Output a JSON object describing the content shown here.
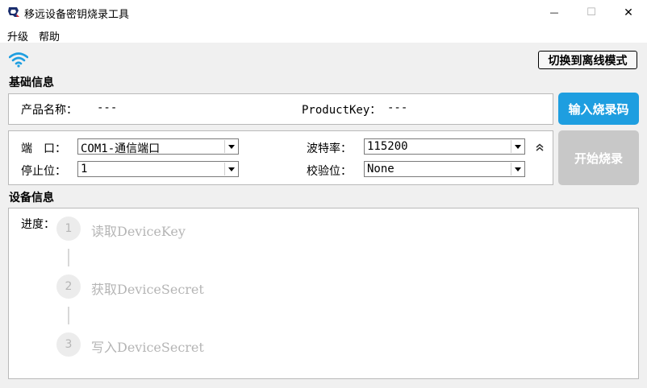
{
  "window": {
    "title": "移远设备密钥烧录工具",
    "minimize_glyph": "—",
    "maximize_glyph": "☐",
    "close_glyph": "✕"
  },
  "menu": {
    "upgrade": "升级",
    "help": "帮助"
  },
  "toolbar": {
    "wifi_icon": "wifi-icon",
    "offline_mode_button": "切换到离线模式"
  },
  "basic_info": {
    "section_title": "基础信息",
    "product_name_label": "产品名称：",
    "product_name_value": "---",
    "product_key_label": "ProductKey：",
    "product_key_value": "---"
  },
  "serial": {
    "port_label": "端　口：",
    "port_value": "COM1-通信端口",
    "stop_bits_label": "停止位：",
    "stop_bits_value": "1",
    "baud_label": "波特率：",
    "baud_value": "115200",
    "parity_label": "校验位：",
    "parity_value": "None"
  },
  "actions": {
    "input_code_button": "输入烧录码",
    "start_button": "开始烧录",
    "primary_color": "#1e9ee0",
    "disabled_color": "#c8c8c8"
  },
  "device_info": {
    "section_title": "设备信息",
    "progress_label": "进度：",
    "steps": [
      {
        "number": "1",
        "label": "读取DeviceKey"
      },
      {
        "number": "2",
        "label": "获取DeviceSecret"
      },
      {
        "number": "3",
        "label": "写入DeviceSecret"
      }
    ]
  }
}
